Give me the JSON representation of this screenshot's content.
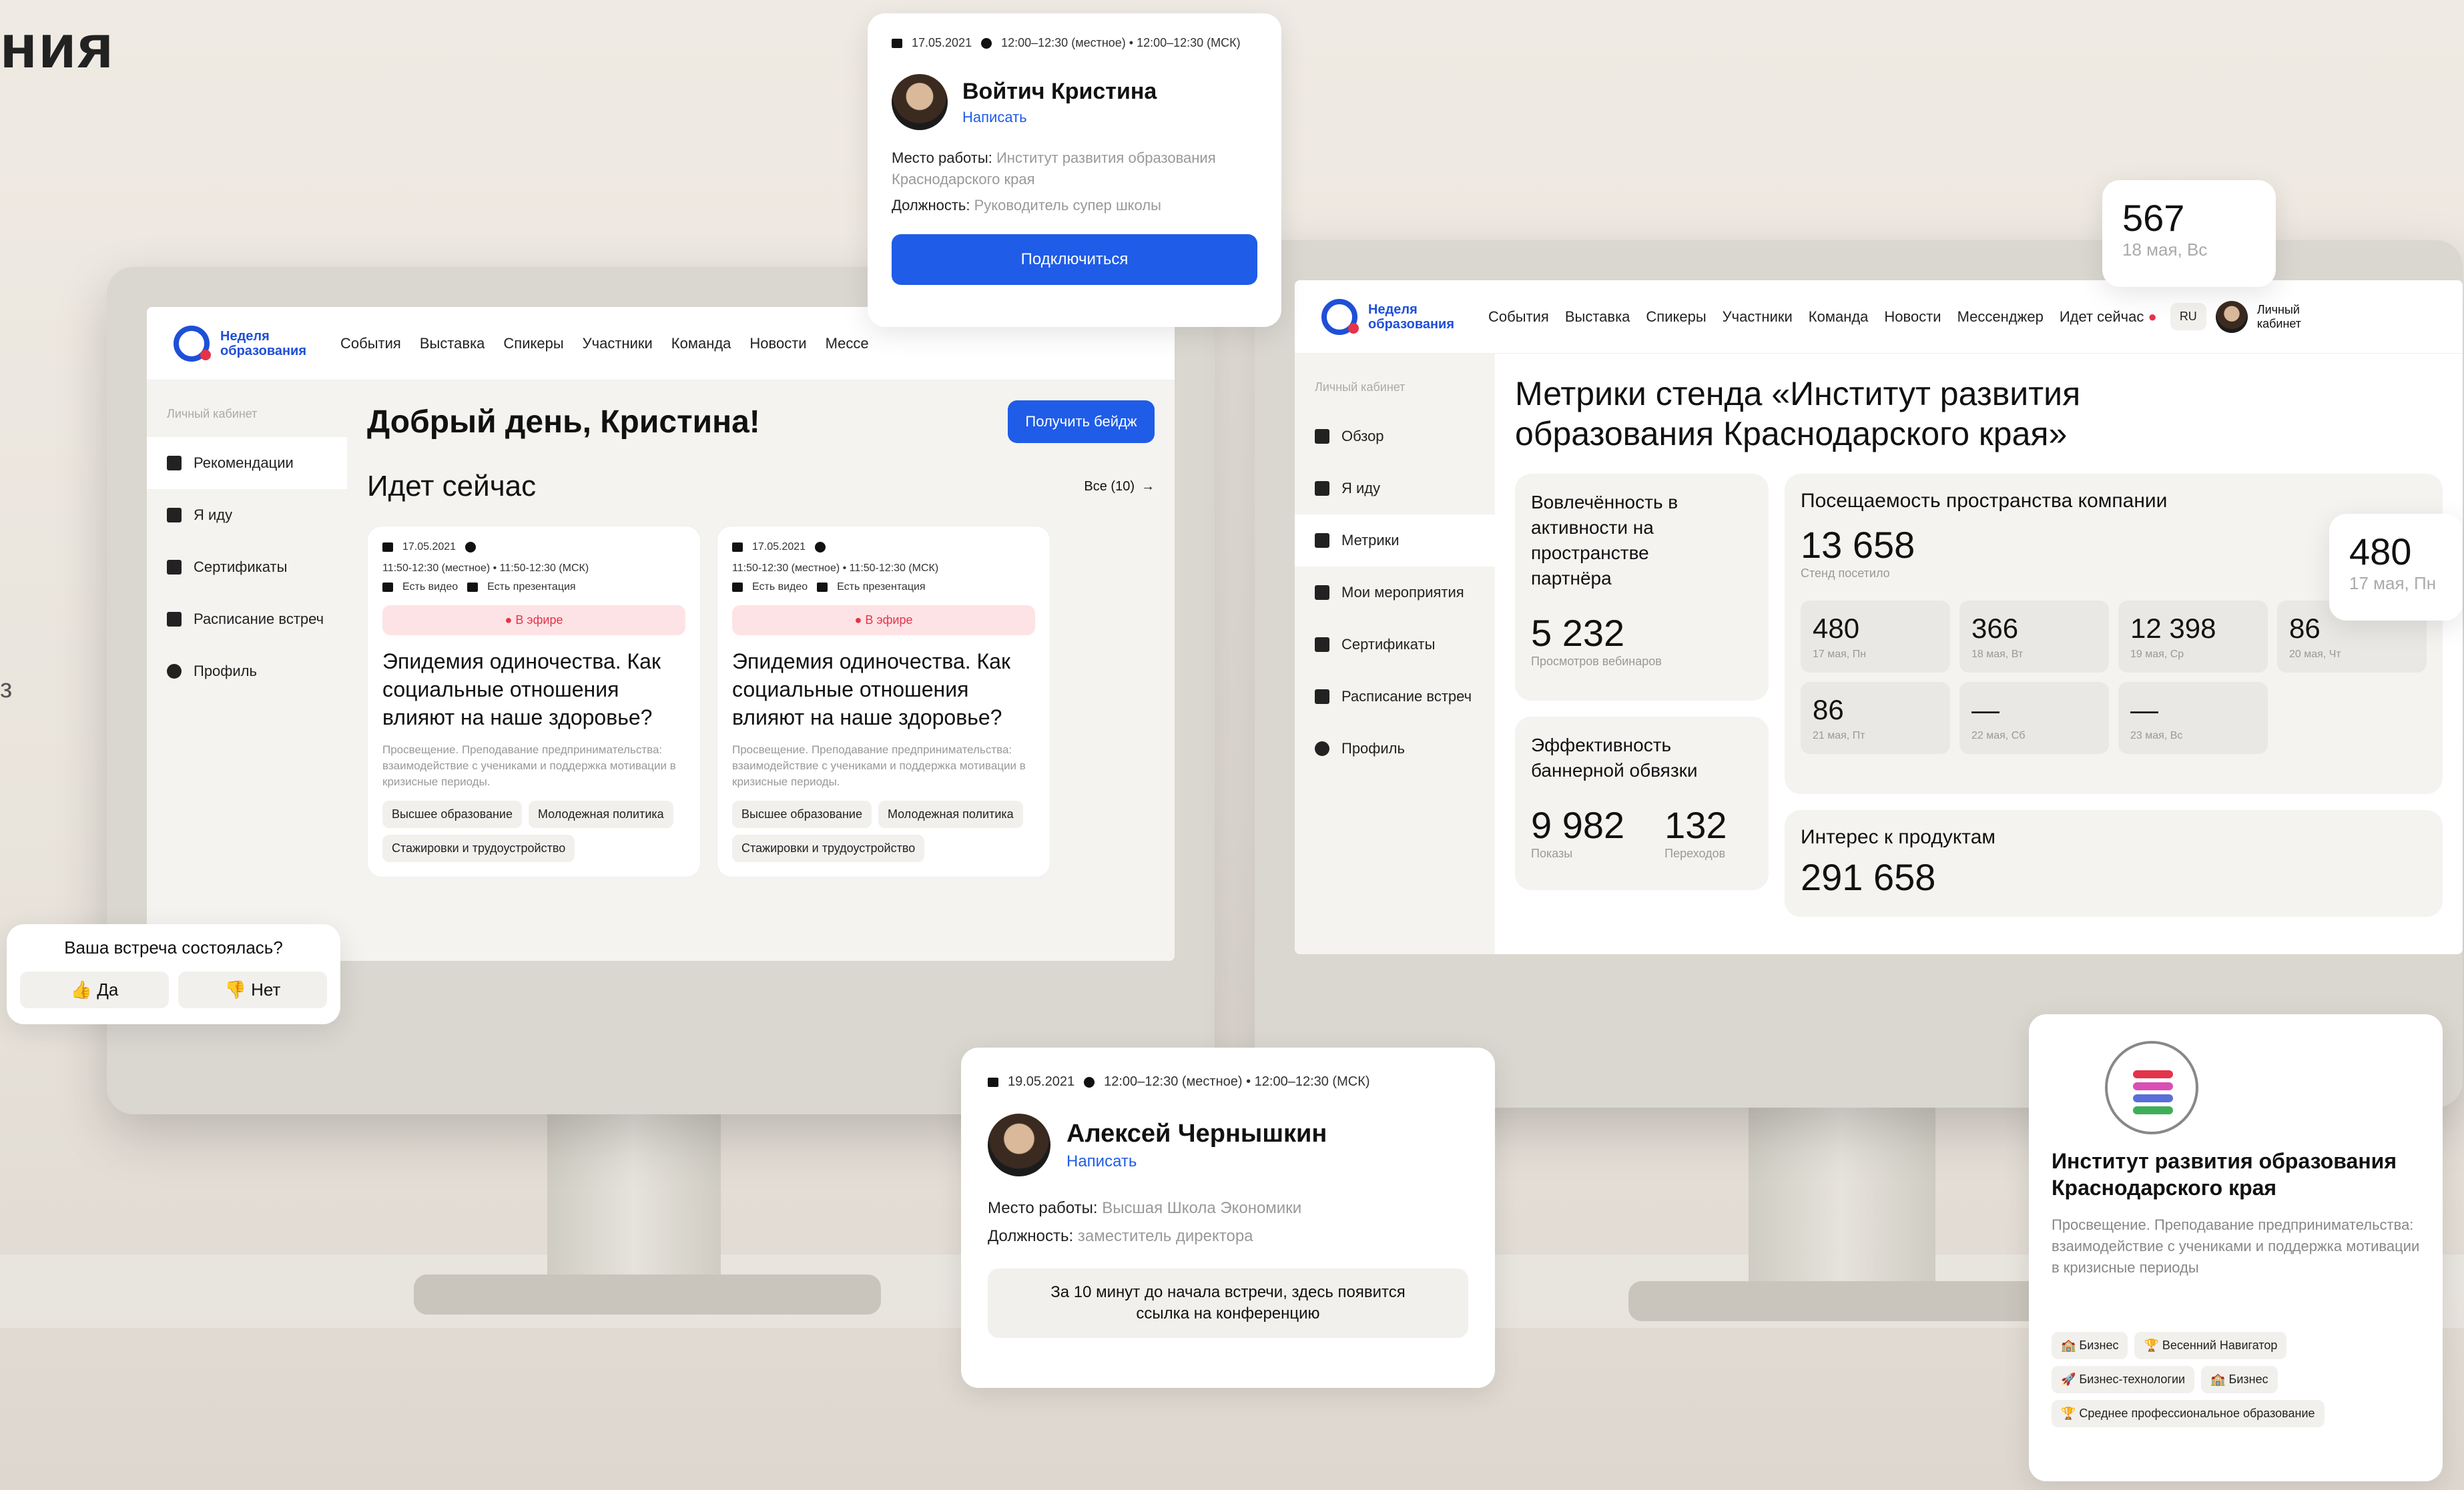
{
  "page": {
    "partial_title": "ния",
    "edge_letter": "з"
  },
  "left_screen": {
    "logo": "Неделя образования",
    "nav": [
      "События",
      "Выставка",
      "Спикеры",
      "Участники",
      "Команда",
      "Новости",
      "Мессе"
    ],
    "sidebar_header": "Личный кабинет",
    "sidebar": [
      "Рекомендации",
      "Я иду",
      "Сертификаты",
      "Расписание встреч",
      "Профиль"
    ],
    "greeting": "Добрый день, Кристина!",
    "badge_button": "Получить бейдж",
    "section_title": "Идет сейчас",
    "all_link": "Все (10)",
    "events": [
      {
        "date": "17.05.2021",
        "time": "11:50-12:30 (местное) • 11:50-12:30 (МСК)",
        "video": "Есть видео",
        "presentation": "Есть презентация",
        "live": "В эфире",
        "title": "Эпидемия одиночества. Как социальные отношения влияют на наше здоровье?",
        "desc": "Просвещение. Преподавание предпринимательства: взаимодействие с учениками и поддержка мотивации в кризисные периоды.",
        "tags": [
          "Высшее образование",
          "Молодежная политика",
          "Стажировки и трудоустройство"
        ]
      },
      {
        "date": "17.05.2021",
        "time": "11:50-12:30 (местное) • 11:50-12:30 (МСК)",
        "video": "Есть видео",
        "presentation": "Есть презентация",
        "live": "В эфире",
        "title": "Эпидемия одиночества. Как социальные отношения влияют на наше здоровье?",
        "desc": "Просвещение. Преподавание предпринимательства: взаимодействие с учениками и поддержка мотивации в кризисные периоды.",
        "tags": [
          "Высшее образование",
          "Молодежная политика",
          "Стажировки и трудоустройство"
        ]
      }
    ]
  },
  "right_screen": {
    "logo": "Неделя образования",
    "nav": [
      "События",
      "Выставка",
      "Спикеры",
      "Участники",
      "Команда",
      "Новости",
      "Мессенджер",
      "Идет сейчас"
    ],
    "lang": "RU",
    "cabinet": "Личный кабинет",
    "sidebar_header": "Личный кабинет",
    "sidebar": [
      "Обзор",
      "Я иду",
      "Метрики",
      "Мои мероприятия",
      "Сертификаты",
      "Расписание встреч",
      "Профиль"
    ],
    "title": "Метрики стенда «Институт развития образования Краснодарского края»",
    "engagement": {
      "label": "Вовлечённость в активности на пространстве партнёра",
      "value": "5 232",
      "sub": "Просмотров вебинаров"
    },
    "attendance": {
      "label": "Посещаемость пространства компании",
      "value": "13 658",
      "sub": "Стенд посетило",
      "days": [
        {
          "v": "480",
          "d": "17 мая, Пн"
        },
        {
          "v": "366",
          "d": "18 мая, Вт"
        },
        {
          "v": "12 398",
          "d": "19 мая, Ср"
        },
        {
          "v": "86",
          "d": "20 мая, Чт"
        },
        {
          "v": "86",
          "d": "21 мая, Пт"
        },
        {
          "v": "—",
          "d": "22 мая, Сб"
        },
        {
          "v": "—",
          "d": "23 мая, Вс"
        }
      ]
    },
    "banner": {
      "label": "Эффективность баннерной обвязки",
      "shows": "9 982",
      "shows_label": "Показы",
      "clicks": "132",
      "clicks_label": "Переходов"
    },
    "interest": {
      "label": "Интерес к продуктам",
      "value": "291 658"
    }
  },
  "float_567": {
    "value": "567",
    "date": "18 мая, Вс"
  },
  "float_480": {
    "value": "480",
    "date": "17 мая, Пн"
  },
  "person_card_top": {
    "date": "17.05.2021",
    "time": "12:00–12:30 (местное) • 12:00–12:30 (МСК)",
    "name": "Войтич Кристина",
    "write": "Написать",
    "work_label": "Место работы:",
    "work_value": "Институт развития образования Краснодарского края",
    "role_label": "Должность:",
    "role_value": "Руководитель супер школы",
    "connect": "Подключиться"
  },
  "meeting_poll": {
    "question": "Ваша встреча состоялась?",
    "yes": "👍 Да",
    "no": "👎 Нет"
  },
  "person_card_bottom": {
    "date": "19.05.2021",
    "time": "12:00–12:30 (местное) • 12:00–12:30 (МСК)",
    "name": "Алексей Чернышкин",
    "write": "Написать",
    "work_label": "Место работы:",
    "work_value": "Высшая Школа Экономики",
    "role_label": "Должность:",
    "role_value": "заместитель директора",
    "notice": "За 10 минут до начала встречи, здесь появится ссылка на конференцию"
  },
  "org_card": {
    "name": "Институт развития образования Краснодарского края",
    "desc": "Просвещение. Преподавание предпринимательства: взаимодействие с учениками и поддержка мотивации в кризисные периоды",
    "tags": [
      "🏫 Бизнес",
      "🏆 Весенний Навигатор",
      "🚀 Бизнес-технологии",
      "🏫 Бизнес",
      "🏆 Среднее профессиональное образование"
    ]
  },
  "colors": {
    "accent": "#1f5ce8",
    "live": "#e5334b",
    "bg": "#ece7e0"
  }
}
